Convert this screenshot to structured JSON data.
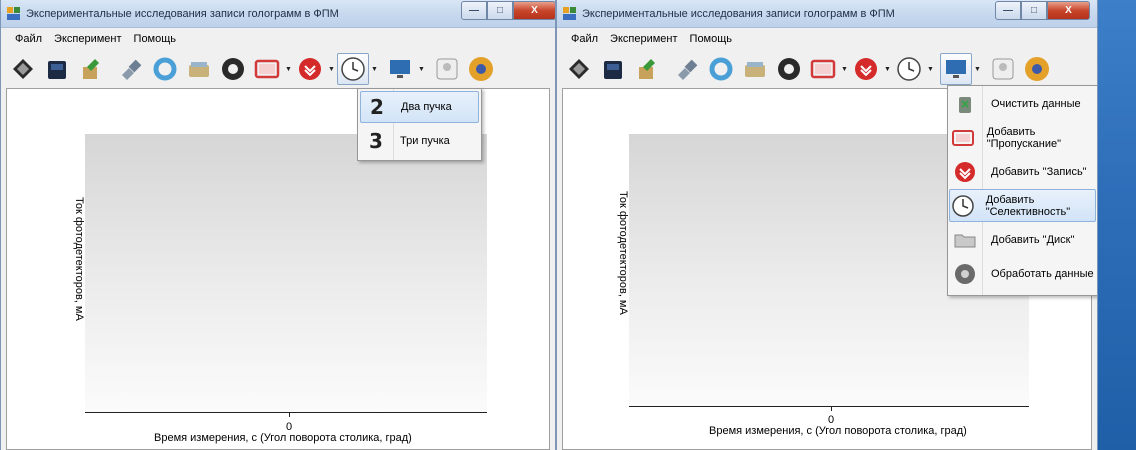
{
  "app": {
    "title": "Экспериментальные исследования записи голограмм в ФПМ"
  },
  "menu": {
    "file": "Файл",
    "experiment": "Эксперимент",
    "help": "Помощь"
  },
  "caption": {
    "min": "—",
    "max": "□",
    "close": "X"
  },
  "chart": {
    "ylabel": "Ток фотодетекторов, мА",
    "xlabel": "Время измерения, с (Угол поворота столика, град)",
    "x_tick": "0"
  },
  "chart_data": [
    {
      "type": "line",
      "x": [],
      "series": [],
      "xlabel": "Время измерения, с (Угол поворота столика, град)",
      "ylabel": "Ток фотодетекторов, мА",
      "x_ticks": [
        "0"
      ],
      "grid": false
    },
    {
      "type": "line",
      "x": [],
      "series": [],
      "xlabel": "Время измерения, с (Угол поворота столика, град)",
      "ylabel": "Ток фотодетекторов, мА",
      "x_ticks": [
        "0"
      ],
      "grid": false
    }
  ],
  "beams_menu": {
    "items": [
      {
        "digit": "2",
        "label": "Два пучка",
        "highlighted": true
      },
      {
        "digit": "3",
        "label": "Три пучка",
        "highlighted": false
      }
    ]
  },
  "display_menu": {
    "items": [
      {
        "icon": "recycle-bin-icon",
        "label": "Очистить данные"
      },
      {
        "icon": "laptop-icon",
        "label": "Добавить \"Пропускание\""
      },
      {
        "icon": "red-download-icon",
        "label": "Добавить \"Запись\""
      },
      {
        "icon": "clock-icon",
        "label": "Добавить \"Селективность\"",
        "highlighted": true
      },
      {
        "icon": "folder-disk-icon",
        "label": "Добавить \"Диск\""
      },
      {
        "icon": "process-gear-icon",
        "label": "Обработать данные"
      }
    ]
  },
  "colors": {
    "titlebar": "#c6d8ee",
    "highlight": "#d2e4f7",
    "desktop": "#2f6fba",
    "close_button": "#c9462c"
  }
}
